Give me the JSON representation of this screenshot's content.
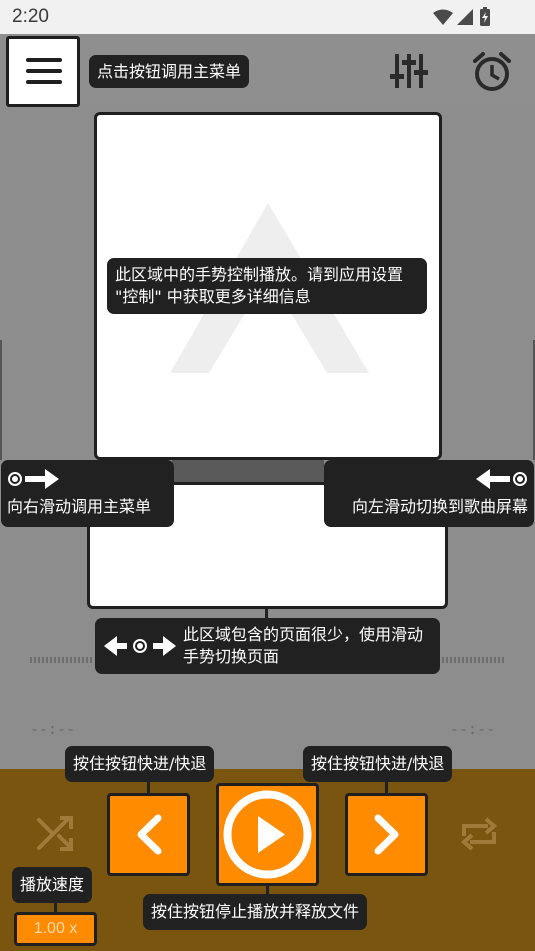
{
  "status_bar": {
    "time": "2:20"
  },
  "tooltips": {
    "menu": "点击按钮调用主菜单",
    "gesture_area": "此区域中的手势控制播放。请到应用设置 \"控制\" 中获取更多详细信息",
    "swipe_right_main_menu": "向右滑动调用主菜单",
    "swipe_left_song_screen": "向左滑动切换到歌曲屏幕",
    "few_pages": "此区域包含的页面很少，使用滑动手势切换页面",
    "hold_seek_left": "按住按钮快进/快退",
    "hold_seek_right": "按住按钮快进/快退",
    "playback_speed": "播放速度",
    "hold_stop": "按住按钮停止播放并释放文件"
  },
  "player": {
    "time_elapsed": "--:--",
    "time_total": "--:--",
    "speed_value": "1.00 x"
  },
  "icons": {
    "menu": "hamburger-icon",
    "equalizer": "equalizer-icon",
    "alarm": "alarm-clock-icon",
    "shuffle": "shuffle-icon",
    "repeat": "repeat-icon",
    "prev": "chevron-left-icon",
    "play": "play-icon",
    "next": "chevron-right-icon"
  },
  "colors": {
    "accent": "#ff8c00",
    "bottom_bar": "#7a5510",
    "background": "#8d8d8d",
    "tooltip_bg": "#212121"
  }
}
